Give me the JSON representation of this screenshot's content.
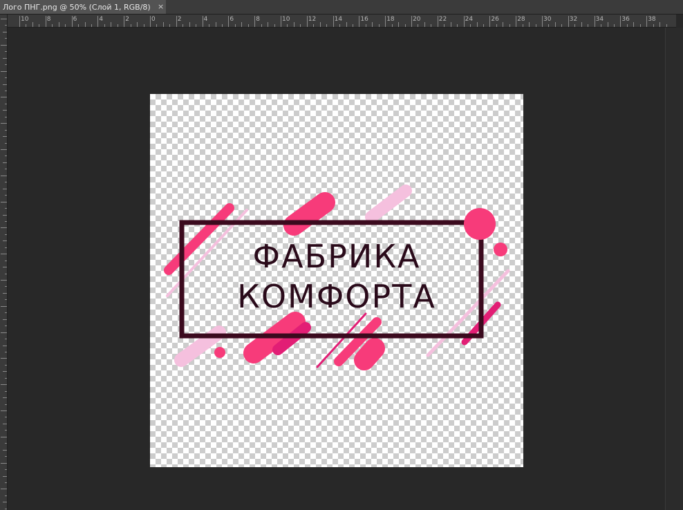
{
  "document_tab": {
    "title": "Лого ПНГ.png @ 50% (Слой 1, RGB/8)",
    "close_symbol": "×"
  },
  "ruler": {
    "labels": [
      "10",
      "8",
      "6",
      "4",
      "2",
      "0",
      "2",
      "4",
      "6",
      "8",
      "10",
      "12",
      "14",
      "16",
      "18",
      "20",
      "22",
      "24",
      "26",
      "28",
      "30",
      "32",
      "34",
      "36",
      "38"
    ]
  },
  "logo": {
    "line1": "ФАБРИКА",
    "line2": "КОМФОРТА",
    "colors": {
      "text": "#2a0a1a",
      "frame": "#3b0a1e",
      "hot_pink": "#f73b7a",
      "magenta": "#e21e75",
      "light_pink": "#f5c0de"
    }
  },
  "colors": {
    "workspace": "#282828",
    "tabbar": "#3b3b3b",
    "active_tab": "#535353"
  }
}
